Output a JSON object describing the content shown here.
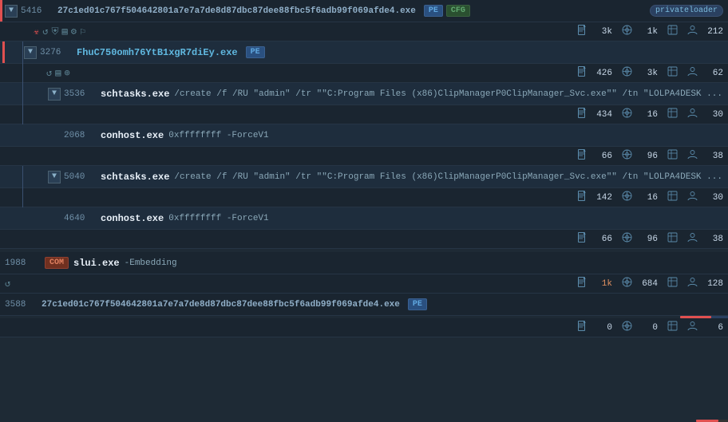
{
  "rows": [
    {
      "id": "row-5416",
      "type": "process",
      "level": "top-level",
      "pid": "5416",
      "name": "27c1ed01c767f504642801a7e7a7de8d87dbc87dee88fbc5f6adb99f069afde4.exe",
      "args": "",
      "badges": [
        "PE",
        "CFG"
      ],
      "tag": "privateloader",
      "leftBorder": "red",
      "collapsed": false,
      "icons": [
        "biohazard",
        "undo",
        "shield",
        "script",
        "gear",
        "flag"
      ]
    },
    {
      "id": "stats-5416",
      "type": "stats",
      "level": "top-level",
      "file": "3k",
      "net": "1k",
      "reg": "",
      "proc": "212",
      "hasRedBar": true
    },
    {
      "id": "row-3276",
      "type": "process",
      "level": "child-l1",
      "pid": "3276",
      "name": "FhuC750omh76YtB1xgR7diEy.exe",
      "args": "",
      "badges": [
        "PE"
      ],
      "tag": "",
      "leftBorder": "red",
      "collapsed": false,
      "icons": []
    },
    {
      "id": "stats-3276",
      "type": "stats",
      "level": "child-l1",
      "file": "426",
      "net": "3k",
      "reg": "",
      "proc": "62",
      "hasRedBar": false
    },
    {
      "id": "icons-3276",
      "type": "icons-row",
      "level": "child-l1",
      "icons": [
        "undo",
        "script",
        "globe"
      ]
    },
    {
      "id": "row-3536",
      "type": "process",
      "level": "child-l2",
      "pid": "3536",
      "name": "schtasks.exe",
      "args": "/create /f /RU \"admin\" /tr \"\"C:\\Program Files (x86)\\ClipManagerP0\\ClipManager_Svc.exe\"\" /tn \"LOLPA4DESK ...",
      "badges": [],
      "tag": "",
      "leftBorder": "",
      "collapsed": false,
      "icons": []
    },
    {
      "id": "stats-3536",
      "type": "stats",
      "level": "child-l2",
      "file": "434",
      "net": "16",
      "reg": "",
      "proc": "30",
      "hasRedBar": false
    },
    {
      "id": "row-2068",
      "type": "process",
      "level": "child-l2",
      "pid": "2068",
      "name": "conhost.exe",
      "args": "0xffffffff -ForceV1",
      "badges": [],
      "tag": "",
      "leftBorder": "",
      "collapsed": false,
      "icons": []
    },
    {
      "id": "stats-2068",
      "type": "stats",
      "level": "child-l2",
      "file": "66",
      "net": "96",
      "reg": "",
      "proc": "38",
      "hasRedBar": false
    },
    {
      "id": "row-5040",
      "type": "process",
      "level": "child-l2",
      "pid": "5040",
      "name": "schtasks.exe",
      "args": "/create /f /RU \"admin\" /tr \"\"C:\\Program Files (x86)\\ClipManagerP0\\ClipManager_Svc.exe\"\" /tn \"LOLPA4DESK ...",
      "badges": [],
      "tag": "",
      "leftBorder": "",
      "collapsed": false,
      "icons": []
    },
    {
      "id": "stats-5040",
      "type": "stats",
      "level": "child-l2",
      "file": "142",
      "net": "16",
      "reg": "",
      "proc": "30",
      "hasRedBar": false
    },
    {
      "id": "row-4640",
      "type": "process",
      "level": "child-l2",
      "pid": "4640",
      "name": "conhost.exe",
      "args": "0xffffffff -ForceV1",
      "badges": [],
      "tag": "",
      "leftBorder": "",
      "collapsed": false,
      "icons": []
    },
    {
      "id": "stats-4640",
      "type": "stats",
      "level": "child-l2",
      "file": "66",
      "net": "96",
      "reg": "",
      "proc": "38",
      "hasRedBar": false
    },
    {
      "id": "row-1988",
      "type": "process",
      "level": "top-level",
      "pid": "1988",
      "name": "slui.exe",
      "args": "-Embedding",
      "badges": [
        "COM"
      ],
      "tag": "",
      "leftBorder": "",
      "collapsed": false,
      "icons": [
        "undo"
      ]
    },
    {
      "id": "stats-1988",
      "type": "stats",
      "level": "top-level",
      "file": "1k",
      "net": "684",
      "reg": "",
      "proc": "128",
      "hasRedBar": true,
      "redBarFile": true
    },
    {
      "id": "row-3588",
      "type": "process",
      "level": "top-level",
      "pid": "3588",
      "name": "27c1ed01c767f504642801a7e7a7de8d87dbc87dee88fbc5f6adb99f069afde4.exe",
      "args": "",
      "badges": [
        "PE"
      ],
      "tag": "",
      "leftBorder": "",
      "collapsed": false,
      "icons": []
    },
    {
      "id": "stats-3588",
      "type": "stats",
      "level": "top-level",
      "file": "0",
      "net": "0",
      "reg": "",
      "proc": "6",
      "hasRedBar": false
    }
  ],
  "icons": {
    "biohazard": "☣",
    "undo": "↩",
    "shield": "🛡",
    "script": "📋",
    "gear": "⚙",
    "flag": "⚑",
    "globe": "🌐",
    "file": "📄",
    "network": "⬡",
    "wrench": "🔧"
  }
}
